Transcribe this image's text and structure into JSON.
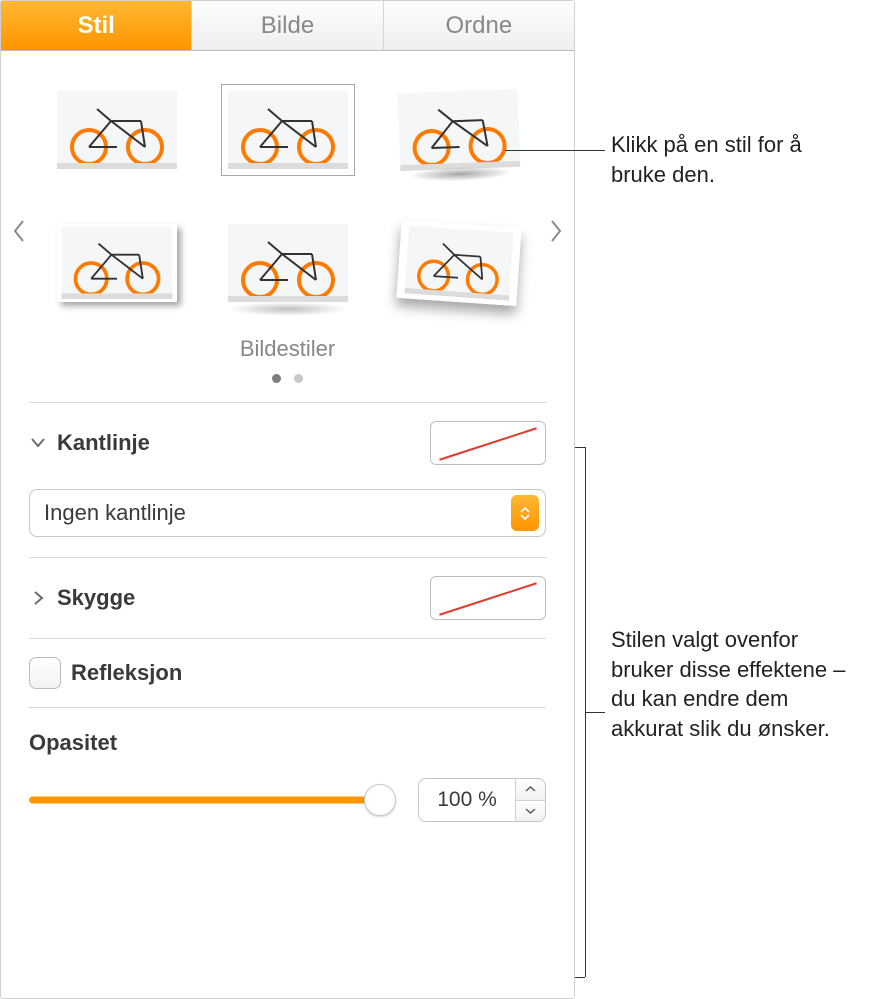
{
  "tabs": {
    "style": "Stil",
    "image": "Bilde",
    "arrange": "Ordne"
  },
  "gallery": {
    "label": "Bildestiler"
  },
  "border": {
    "label": "Kantlinje",
    "select": "Ingen kantlinje"
  },
  "shadow": {
    "label": "Skygge"
  },
  "reflection": {
    "label": "Refleksjon"
  },
  "opacity": {
    "label": "Opasitet",
    "value": "100 %"
  },
  "callouts": {
    "c1": "Klikk på en stil for å bruke den.",
    "c2": "Stilen valgt ovenfor bruker disse effektene – du kan endre dem akkurat slik du ønsker."
  }
}
